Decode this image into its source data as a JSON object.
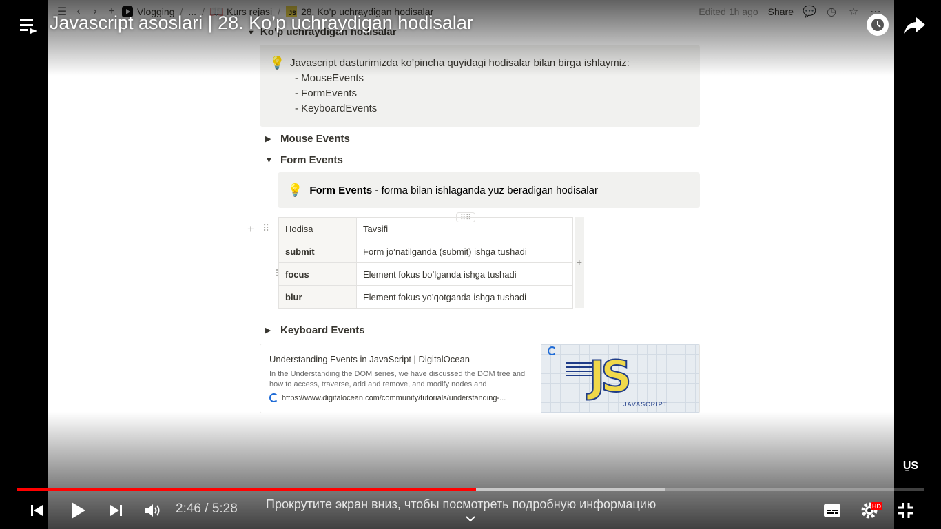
{
  "video": {
    "title": "Javascript asoslari | 28. Ko’p uchraydigan hodisalar",
    "time_current": "2:46",
    "time_separator": " / ",
    "time_total": "5:28",
    "hint": "Прокрутите экран вниз, чтобы посмотреть подробную информацию",
    "quality_badge": "HD",
    "watermark": "U̱S",
    "progress": {
      "played_fraction": 0.506,
      "buffered_fraction": 0.715
    }
  },
  "notion": {
    "breadcrumbs": [
      "Vlogging",
      "...",
      "Kurs rejasi",
      "28. Ko’p uchraydigan hodisalar"
    ],
    "crumb_sep": "/",
    "edited": "Edited 1h ago",
    "share": "Share",
    "heading": "Ko’p uchraydigan hodisalar",
    "callout": {
      "intro": "Javascript dasturimizda ko’pincha quyidagi hodisalar bilan birga ishlaymiz:",
      "items": [
        "- MouseEvents",
        "- FormEvents",
        "- KeyboardEvents"
      ]
    },
    "toggles": {
      "mouse": "Mouse Events",
      "form": "Form Events",
      "keyboard": "Keyboard Events"
    },
    "form_callout": {
      "bold": "Form Events",
      "rest": " - forma bilan ishlaganda yuz beradigan hodisalar"
    },
    "table": {
      "headers": [
        "Hodisa",
        "Tavsifi"
      ],
      "rows": [
        [
          "submit",
          "Form jo’natilganda (submit) ishga tushadi"
        ],
        [
          "focus",
          "Element fokus bo’lganda ishga tushadi"
        ],
        [
          "blur",
          "Element fokus yo’qotganda ishga tushadi"
        ]
      ]
    },
    "bookmark": {
      "title": "Understanding Events in JavaScript | DigitalOcean",
      "description": "In the Understanding the DOM series, we have discussed the DOM tree and how to access, traverse, add and remove, and modify nodes and",
      "url": "https://www.digitalocean.com/community/tutorials/understanding-...",
      "thumb_text": "JS",
      "thumb_caption": "JAVASCRIPT"
    }
  },
  "colors": {
    "progress_played": "#ff0000",
    "callout_bg": "#f1f1ef",
    "notion_text": "#37352f"
  },
  "icons": [
    "playlist-icon",
    "clock-icon",
    "share-icon",
    "previous-icon",
    "play-icon",
    "next-icon",
    "volume-icon",
    "subtitles-icon",
    "settings-icon",
    "exit-fullscreen-icon",
    "chevron-down-icon"
  ]
}
